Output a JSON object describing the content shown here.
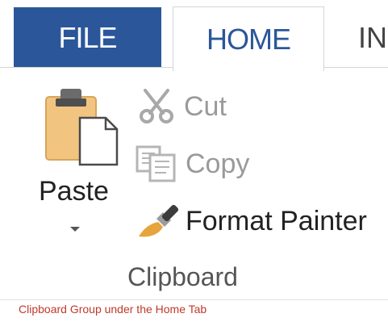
{
  "ribbon": {
    "tabs": {
      "file": "FILE",
      "home": "HOME",
      "insert_partial": "IN"
    },
    "clipboard": {
      "paste_label": "Paste",
      "cut_label": "Cut",
      "copy_label": "Copy",
      "format_painter_label": "Format Painter",
      "group_label": "Clipboard"
    },
    "icons": {
      "paste": "clipboard-paste-icon",
      "cut": "scissors-icon",
      "copy": "copy-icon",
      "format_painter": "paintbrush-icon",
      "dropdown": "chevron-down-icon"
    },
    "colors": {
      "file_tab": "#2b579a",
      "active_tab_text": "#2b579a",
      "disabled_text": "#9a9a9a",
      "caption": "#c0392b"
    }
  },
  "caption": "Clipboard Group under the Home Tab"
}
